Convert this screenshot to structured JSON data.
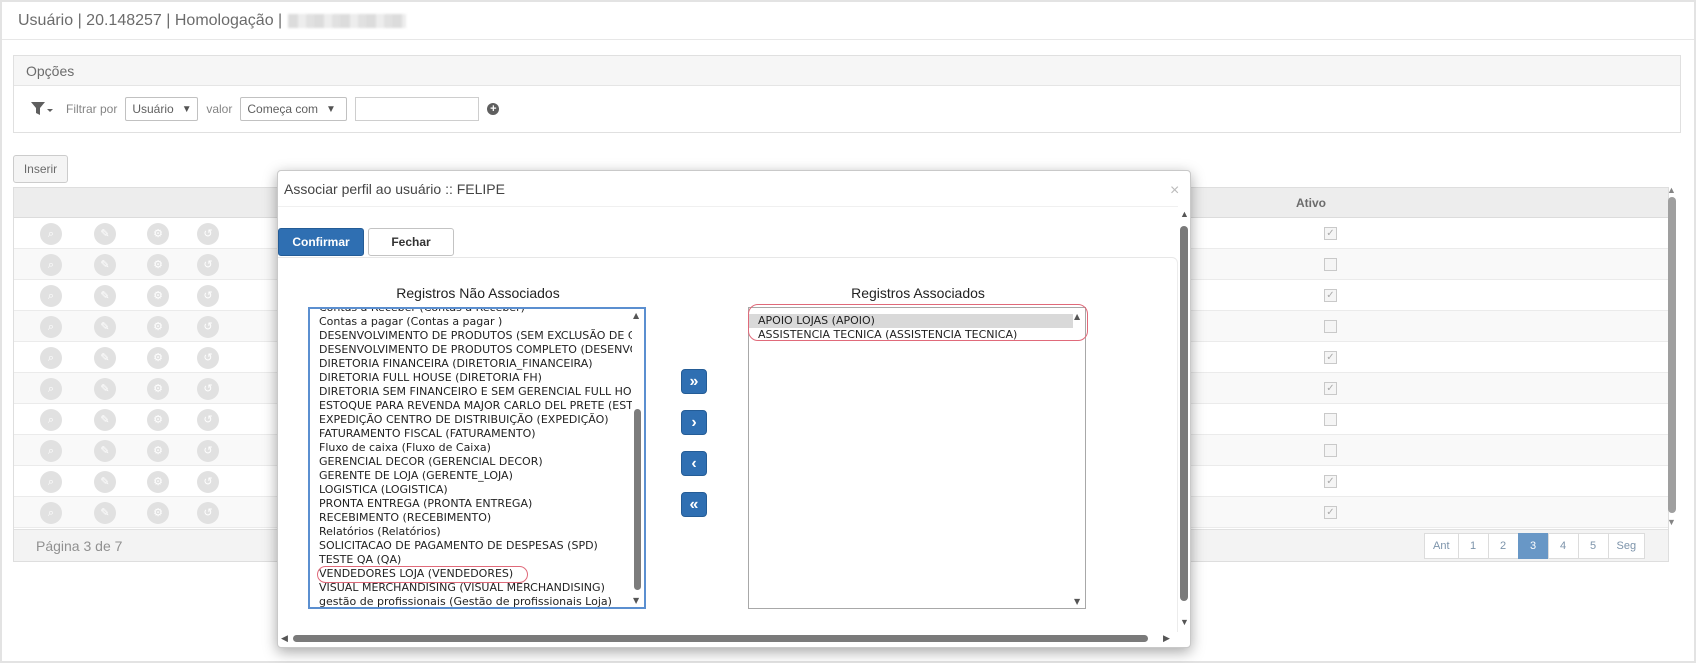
{
  "header": {
    "prefix": "Usuário | 20.148257 | Homologação |"
  },
  "options": {
    "title": "Opções",
    "filter_by_label": "Filtrar por",
    "filter_field_value": "Usuário",
    "value_label": "valor",
    "match_mode_value": "Começa com",
    "search_value": ""
  },
  "toolbar": {
    "insert_label": "Inserir"
  },
  "grid": {
    "column_active": "Ativo",
    "rows_active": [
      true,
      false,
      true,
      false,
      true,
      true,
      false,
      false,
      true,
      true
    ],
    "page_info": "Página 3 de 7",
    "pager": [
      "Ant",
      "1",
      "2",
      "3",
      "4",
      "5",
      "Seg"
    ],
    "current_page": "3"
  },
  "modal": {
    "title": "Associar perfil ao usuário :: FELIPE",
    "close_glyph": "×",
    "confirm_label": "Confirmar",
    "close_label": "Fechar",
    "left_heading": "Registros Não Associados",
    "right_heading": "Registros Associados",
    "left_items": [
      "Contas a Receber (Contas a Receber)",
      "Contas a pagar (Contas a pagar )",
      "DESENVOLVIMENTO DE PRODUTOS (SEM EXCLUSÃO DE CUSTOS)",
      "DESENVOLVIMENTO DE PRODUTOS COMPLETO (DESENVOLVIMENTO)",
      "DIRETORIA FINANCEIRA (DIRETORIA_FINANCEIRA)",
      "DIRETORIA FULL HOUSE (DIRETORIA FH)",
      "DIRETORIA SEM FINANCEIRO E SEM GERENCIAL FULL HOUSE",
      "ESTOQUE PARA REVENDA MAJOR CARLO DEL PRETE (ESTOQUE)",
      "EXPEDIÇÃO CENTRO DE DISTRIBUIÇÃO (EXPEDIÇÃO)",
      "FATURAMENTO FISCAL (FATURAMENTO)",
      "Fluxo de caixa (Fluxo de Caixa)",
      "GERENCIAL DECOR (GERENCIAL DECOR)",
      "GERENTE DE LOJA (GERENTE_LOJA)",
      "LOGISTICA (LOGISTICA)",
      "PRONTA ENTREGA (PRONTA ENTREGA)",
      "RECEBIMENTO (RECEBIMENTO)",
      "Relatórios (Relatórios)",
      "SOLICITACAO DE PAGAMENTO DE DESPESAS (SPD)",
      "TESTE QA (QA)",
      "VENDEDORES LOJA (VENDEDORES)",
      "VISUAL MERCHANDISING (VISUAL MERCHANDISING)",
      "gestão de profissionais (Gestão de profissionais Loja)"
    ],
    "right_items": [
      "APOIO LOJAS (APOIO)",
      "ASSISTENCIA TECNICA (ASSISTENCIA TECNICA)"
    ],
    "transfer_buttons": {
      "move_all_right": "»",
      "move_right": "›",
      "move_left": "‹",
      "move_all_left": "«"
    }
  }
}
